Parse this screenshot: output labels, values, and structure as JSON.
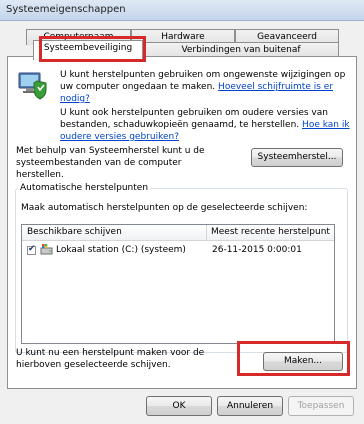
{
  "window": {
    "title": "Systeemeigenschappen"
  },
  "tabs": {
    "row_back": [
      "Computernaam",
      "Hardware",
      "Geavanceerd"
    ],
    "row_front": [
      "Systeembeveiliging",
      "Verbindingen van buitenaf"
    ],
    "active": "Systeembeveiliging"
  },
  "intro": {
    "text": "U kunt herstelpunten gebruiken om ongewenste wijzigingen op uw computer ongedaan te maken.",
    "link": "Hoeveel schijfruimte is er nodig?"
  },
  "old_versions": {
    "text": "U kunt ook herstelpunten gebruiken om oudere versies van bestanden, schaduwkopieën genaamd, te herstellen.",
    "link_part1": "Hoe kan ik",
    "link_part2": "oudere versies gebruiken?"
  },
  "system_restore": {
    "text": "Met behulp van Systeemherstel kunt u de systeembestanden van de computer herstellen.",
    "button": "Systeemherstel..."
  },
  "auto_restore": {
    "legend": "Automatische herstelpunten",
    "description": "Maak automatisch herstelpunten op de geselecteerde schijven:",
    "columns": [
      "Beschikbare schijven",
      "Meest recente herstelpunt"
    ],
    "rows": [
      {
        "checked": true,
        "drive": "Lokaal station (C:) (systeem)",
        "date": "26-11-2015 0:00:01"
      }
    ]
  },
  "create": {
    "text": "U kunt nu een herstelpunt maken voor de hierboven geselecteerde schijven.",
    "button": "Maken..."
  },
  "footer": {
    "ok": "OK",
    "cancel": "Annuleren",
    "apply": "Toepassen"
  },
  "highlight_color": "#d62a2a"
}
